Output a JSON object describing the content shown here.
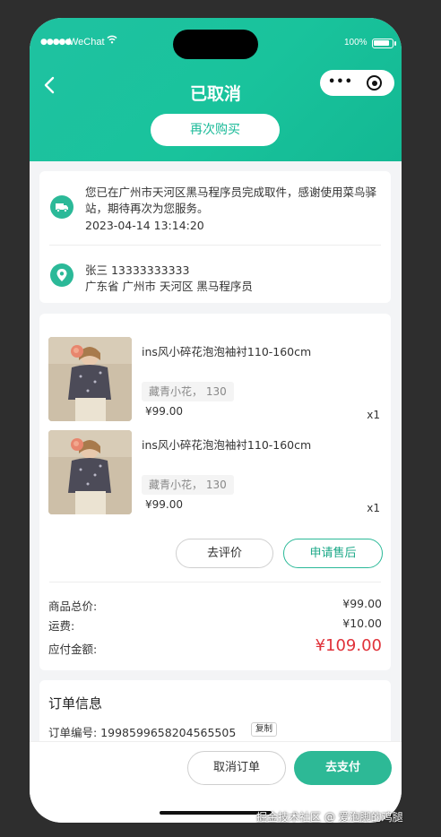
{
  "status_bar": {
    "signal": "●●●●●",
    "carrier": "WeChat",
    "battery_pct": "100%"
  },
  "header": {
    "title": "已取消",
    "rebuy_label": "再次购买",
    "capsule_menu": "•••"
  },
  "delivery": {
    "message": "您已在广州市天河区黑马程序员完成取件，感谢使用菜鸟驿站，期待再次为您服务。",
    "time": "2023-04-14 13:14:20",
    "icon": "truck-icon"
  },
  "address": {
    "name_phone": "张三 13333333333",
    "detail": "广东省 广州市 天河区 黑马程序员",
    "icon": "location-pin-icon"
  },
  "goods": [
    {
      "name": "ins风小碎花泡泡袖衬110-160cm",
      "spec": "藏青小花， 130",
      "price": "¥99.00",
      "qty": "x1"
    },
    {
      "name": "ins风小碎花泡泡袖衬110-160cm",
      "spec": "藏青小花， 130",
      "price": "¥99.00",
      "qty": "x1"
    }
  ],
  "goods_actions": {
    "review_label": "去评价",
    "aftersale_label": "申请售后"
  },
  "summary": {
    "subtotal_label": "商品总价:",
    "subtotal_value": "¥99.00",
    "shipping_label": "运费:",
    "shipping_value": "¥10.00",
    "payable_label": "应付金额:",
    "payable_value": "¥109.00"
  },
  "order_info": {
    "title": "订单信息",
    "order_no": "订单编号: 1998599658204565505",
    "copy_label": "复制"
  },
  "bottom_bar": {
    "cancel_label": "取消订单",
    "pay_label": "去支付"
  },
  "watermark": "掘金技术社区 @ 爱泡脚的鸡腿",
  "colors": {
    "brand": "#1fc2a1",
    "price_red": "#e0323a",
    "pay_button": "#2db996"
  }
}
